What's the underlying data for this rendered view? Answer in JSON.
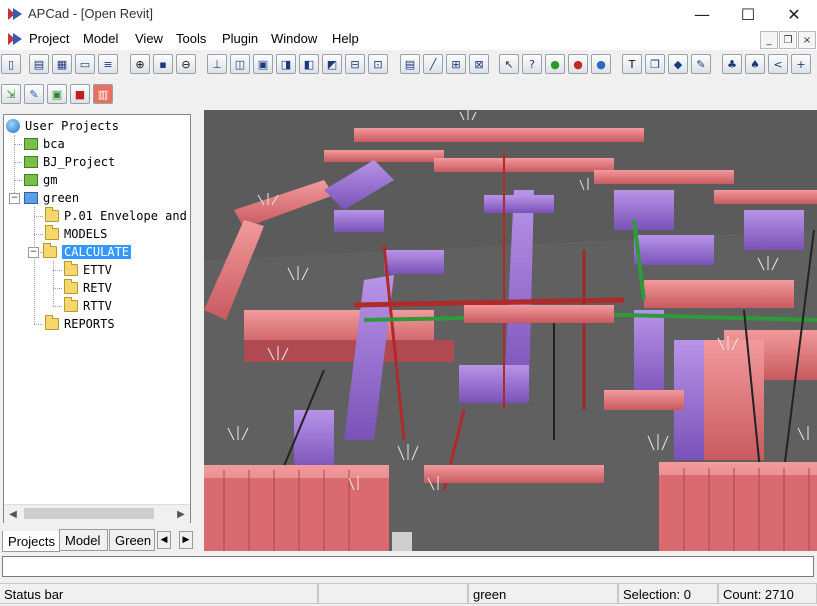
{
  "window": {
    "title": "APCad - [Open Revit]",
    "controls": {
      "minimize": "—",
      "maximize": "☐",
      "close": "✕"
    }
  },
  "menu": {
    "items": [
      "Project",
      "Model",
      "View",
      "Tools",
      "Plugin",
      "Window",
      "Help"
    ],
    "mdi_controls": {
      "minimize": "_",
      "restore": "❐",
      "close": "×"
    }
  },
  "toolbar": {
    "row1_icons": [
      "new-icon",
      "open-icon",
      "grid-icon",
      "window-icon",
      "list-icon",
      "zoom-in-icon",
      "save-icon",
      "zoom-out-icon",
      "axis-icon",
      "box-icon",
      "view-front-icon",
      "view-back-icon",
      "view-left-icon",
      "view-right-icon",
      "view-top-icon",
      "view-bottom-icon",
      "properties-icon",
      "line-icon",
      "align-center-icon",
      "align-h-icon",
      "pointer-icon",
      "help-pointer-icon",
      "select-green-icon",
      "select-red-icon",
      "select-blue-icon",
      "text-icon",
      "copy-icon",
      "shape-icon",
      "pen-icon",
      "tree-icon",
      "tree2-icon",
      "share-icon",
      "tree-add-icon"
    ],
    "row2_icons": [
      "import-icon",
      "edit-icon",
      "image-icon",
      "lock-icon",
      "delete-icon"
    ]
  },
  "tree": {
    "root": "User Projects",
    "projects": [
      "bca",
      "BJ_Project",
      "gm",
      "green"
    ],
    "green_children": [
      "P.01 Envelope and",
      "MODELS",
      "CALCULATE",
      "REPORTS"
    ],
    "calculate_children": [
      "ETTV",
      "RETV",
      "RTTV"
    ],
    "expand_minus": "−"
  },
  "tabs": [
    "Projects",
    "Model",
    "Green Mark"
  ],
  "tab_nav": {
    "prev": "◀",
    "next": "▶"
  },
  "scroll": {
    "left": "◀",
    "right": "▶"
  },
  "command_line": {
    "value": ""
  },
  "status": {
    "message": "Status bar",
    "project": "green",
    "selection": "Selection: 0",
    "count": "Count: 2710"
  },
  "colors": {
    "duct_pink": "#e8767a",
    "duct_purple": "#9b6fd1",
    "pipe_red": "#b02a2a",
    "pipe_green": "#2f9a3a",
    "viewport_bg": "#5a5a5a",
    "selection": "#3399ff"
  }
}
